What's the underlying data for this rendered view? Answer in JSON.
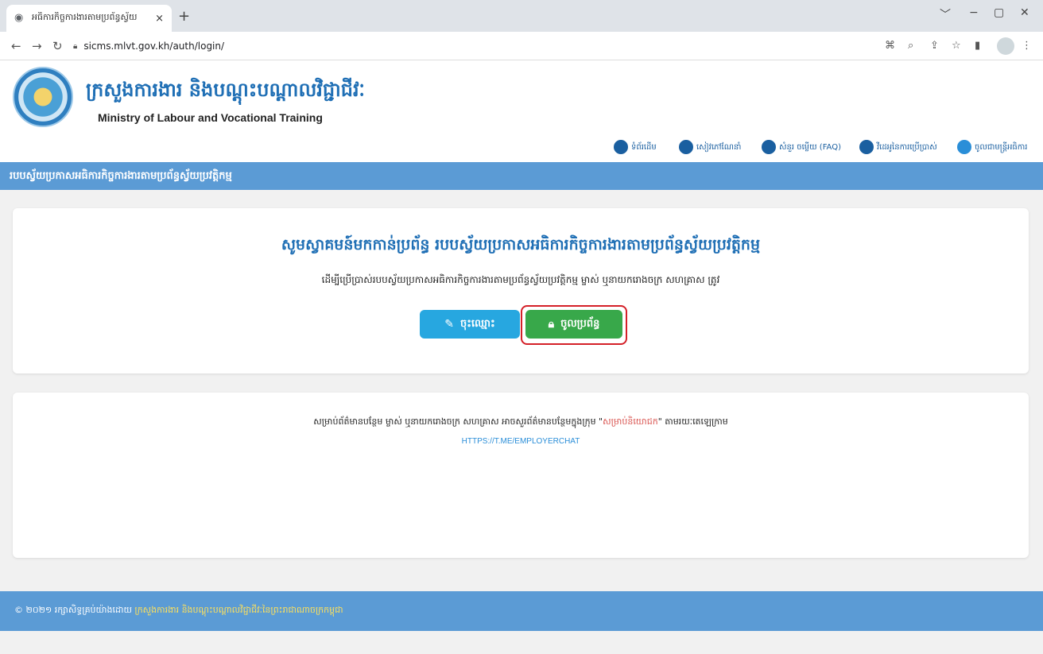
{
  "browser": {
    "tab_title": "អធិការកិច្ចការងារតាមប្រព័ន្ធស្វ័យ",
    "new_tab": "+",
    "close_tab": "×",
    "url": "sicms.mlvt.gov.kh/auth/login/",
    "window_controls": [
      "﹀",
      "−",
      "▢",
      "✕"
    ]
  },
  "site": {
    "ministry_kh": "ក្រសួងការងារ និងបណ្តុះបណ្តាលវិជ្ជាជីវៈ",
    "ministry_en": "Ministry of Labour and Vocational Training",
    "nav": [
      {
        "label": "ទំព័រដើម",
        "icon": "home-icon"
      },
      {
        "label": "សៀវភៅណែនាំ",
        "icon": "book-icon"
      },
      {
        "label": "សំនួរ ចម្លើយ (FAQ)",
        "icon": "chat-icon"
      },
      {
        "label": "វីដេអូនៃការប្រើប្រាស់",
        "icon": "video-icon"
      },
      {
        "label": "ចូលជាមន្ត្រីអធិការ",
        "icon": "user-icon"
      }
    ],
    "title_bar": "របបស្វ័យប្រកាសអធិការកិច្ចការងារតាមប្រព័ន្ធស្វ័យប្រវត្តិកម្ម"
  },
  "welcome": {
    "heading": "សូមស្វាគមន៍មកកាន់ប្រព័ន្ធ របបស្វ័យប្រកាសអធិការកិច្ចការងារតាមប្រព័ន្ធស្វ័យប្រវត្តិកម្ម",
    "subtext": "ដើម្បីប្រើប្រាស់របបស្វ័យប្រកាសអធិការកិច្ចការងារតាមប្រព័ន្ធស្វ័យប្រវត្តិកម្ម ម្ចាស់ ឬនាយករោងចក្រ សហគ្រាស ត្រូវ",
    "register_label": "ចុះឈ្មោះ",
    "login_label": "ចូលប្រព័ន្ធ"
  },
  "info": {
    "text_before": "សម្រាប់ព័ត៌មានបន្ថែម ម្ចាស់ ឬនាយករោងចក្រ សហគ្រាស អាចសួរព័ត៌មានបន្ថែមក្នុងក្រុម \"",
    "group_name": "សម្រាប់និយោជក",
    "text_after": "\" តាមរយៈតេឡេក្រាម",
    "link": "HTTPS://T.ME/EMPLOYERCHAT"
  },
  "footer": {
    "copyright": "© ២០២១ រក្សាសិទ្ធគ្រប់យ៉ាងដោយ ",
    "owner": "ក្រសួងការងារ និងបណ្តុះបណ្តាលវិជ្ជាជីវៈនៃព្រះរាជាណាចក្រកម្ពុជា"
  },
  "colors": {
    "primary_blue": "#5b9bd5",
    "login_green": "#38a84a",
    "register_blue": "#27a7e0",
    "highlight_red": "#d42028"
  }
}
